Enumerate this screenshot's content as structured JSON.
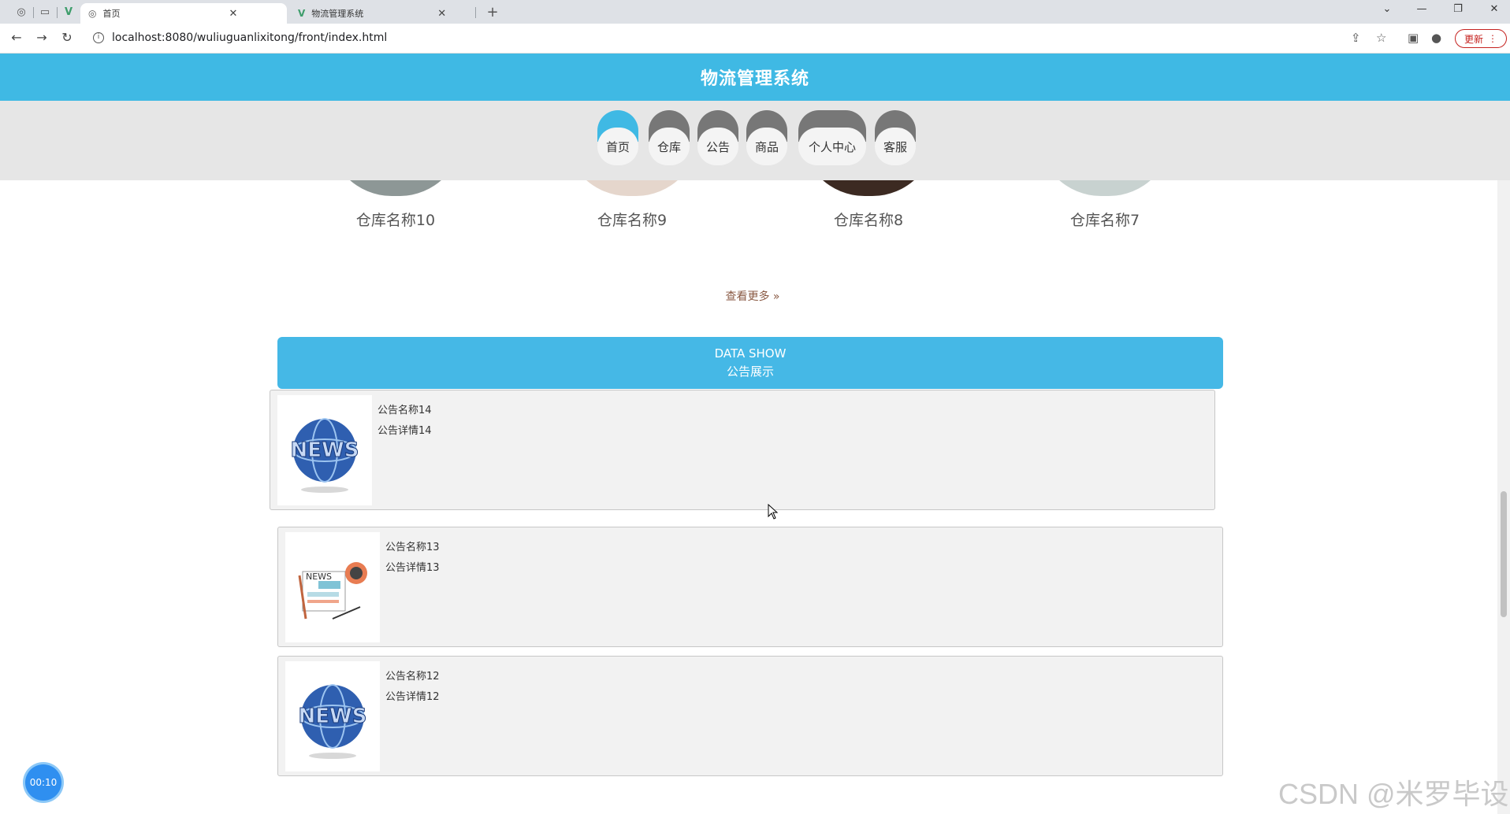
{
  "browser": {
    "tabs": [
      {
        "title": "首页",
        "active": true
      },
      {
        "title": "物流管理系统",
        "active": false
      }
    ],
    "url": "localhost:8080/wuliuguanlixitong/front/index.html",
    "update_label": "更新"
  },
  "header": {
    "title": "物流管理系统"
  },
  "nav": {
    "items": [
      {
        "label": "首页",
        "active": true
      },
      {
        "label": "仓库",
        "active": false
      },
      {
        "label": "公告",
        "active": false
      },
      {
        "label": "商品",
        "active": false
      },
      {
        "label": "个人中心",
        "active": false
      },
      {
        "label": "客服",
        "active": false
      }
    ]
  },
  "warehouses": [
    {
      "name": "仓库名称10"
    },
    {
      "name": "仓库名称9"
    },
    {
      "name": "仓库名称8"
    },
    {
      "name": "仓库名称7"
    }
  ],
  "more_label": "查看更多 »",
  "section": {
    "en": "DATA SHOW",
    "cn": "公告展示"
  },
  "notices": [
    {
      "title": "公告名称14",
      "detail": "公告详情14",
      "icon": "news-globe-icon"
    },
    {
      "title": "公告名称13",
      "detail": "公告详情13",
      "icon": "newspaper-icon"
    },
    {
      "title": "公告名称12",
      "detail": "公告详情12",
      "icon": "news-globe-icon"
    }
  ],
  "timer": "00:10",
  "watermark": "CSDN @米罗毕设",
  "colors": {
    "primary": "#3fb9e4",
    "nav_bg": "#e6e6e6",
    "card_bg": "#f2f2f2"
  }
}
